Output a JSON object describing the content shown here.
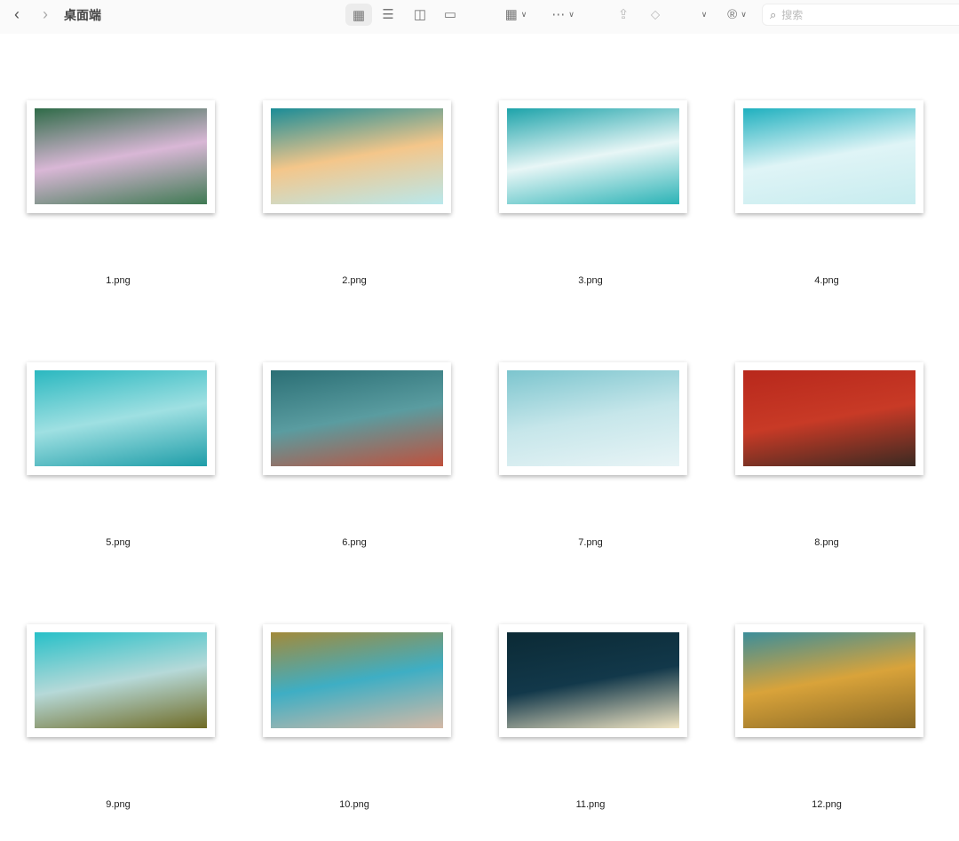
{
  "toolbar": {
    "back_icon": "chevron-left",
    "forward_icon": "chevron-right",
    "title": "桌面端",
    "search_placeholder": "搜索"
  },
  "files": [
    {
      "name": "1.png",
      "colors": [
        "#2f6b48",
        "#d9b7d6",
        "#3f7a53"
      ]
    },
    {
      "name": "2.png",
      "colors": [
        "#1a8c97",
        "#f4c68a",
        "#b9e8ec"
      ]
    },
    {
      "name": "3.png",
      "colors": [
        "#1da3aa",
        "#e8f6f6",
        "#2bb3b6"
      ]
    },
    {
      "name": "4.png",
      "colors": [
        "#1fb0bf",
        "#dff4f6",
        "#c7ecef"
      ]
    },
    {
      "name": "5.png",
      "colors": [
        "#2bb8c0",
        "#9fe0e2",
        "#1e9da8"
      ]
    },
    {
      "name": "6.png",
      "colors": [
        "#2b6f75",
        "#5a9ca0",
        "#c0503c"
      ]
    },
    {
      "name": "7.png",
      "colors": [
        "#7cc5ce",
        "#c6e6ea",
        "#e8f4f6"
      ]
    },
    {
      "name": "8.png",
      "colors": [
        "#b8281c",
        "#c83a26",
        "#3a2a22"
      ]
    },
    {
      "name": "9.png",
      "colors": [
        "#27c0c8",
        "#b6d9d8",
        "#6f6b25"
      ]
    },
    {
      "name": "10.png",
      "colors": [
        "#a38a3a",
        "#3eaec4",
        "#d4b9a6"
      ]
    },
    {
      "name": "11.png",
      "colors": [
        "#0b2a35",
        "#12384a",
        "#f2e6c4"
      ]
    },
    {
      "name": "12.png",
      "colors": [
        "#3c8e9a",
        "#d9a33a",
        "#8a6a26"
      ]
    }
  ]
}
